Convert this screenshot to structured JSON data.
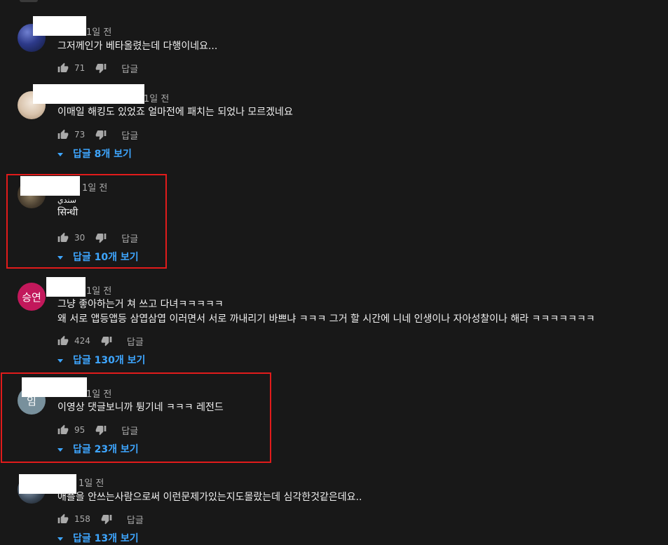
{
  "comments": [
    {
      "time": "1일 전",
      "lines": [
        "그저께인가 베타올렸는데 다행이네요..."
      ],
      "likes": "71",
      "reply_label": "답글",
      "view_replies": ""
    },
    {
      "time": "1일 전",
      "lines": [
        "이매일 해킹도 있었죠 얼마전에 패치는 되었나 모르겠네요"
      ],
      "likes": "73",
      "reply_label": "답글",
      "view_replies": "답글 8개 보기"
    },
    {
      "time": "1일 전",
      "lines": [
        "سندي",
        "सिन्धी"
      ],
      "likes": "30",
      "reply_label": "답글",
      "view_replies": "답글 10개 보기"
    },
    {
      "time": "1일 전",
      "avatar_text": "승연",
      "lines": [
        "그냥 좋아하는거 쳐 쓰고 다녀ㅋㅋㅋㅋㅋ",
        "왜 서로 앱등앱등 삼엽삼엽 이러면서 서로 까내리기 바쁘냐 ㅋㅋㅋ 그거 할 시간에 니네 인생이나 자아성찰이나 해라 ㅋㅋㅋㅋㅋㅋㅋ"
      ],
      "likes": "424",
      "reply_label": "답글",
      "view_replies": "답글 130개 보기"
    },
    {
      "time": "1일 전",
      "avatar_text": "임",
      "lines": [
        "이영상 댓글보니까 튕기네 ㅋㅋㅋ 레전드"
      ],
      "likes": "95",
      "reply_label": "답글",
      "view_replies": "답글 23개 보기"
    },
    {
      "time": "1일 전",
      "lines": [
        "애플을 안쓰는사람으로써 이런문제가있는지도몰랐는데 심각한것같은데요.."
      ],
      "likes": "158",
      "reply_label": "답글",
      "view_replies": "답글 13개 보기"
    }
  ],
  "colors": {
    "background": "#181818",
    "text": "#f1f1f1",
    "meta": "#aaaaaa",
    "link": "#3ea6ff",
    "highlight": "#e11b1b",
    "avatar_pink": "#c2185b",
    "avatar_slate": "#78909c"
  },
  "icons": {
    "like": "thumb-up-icon",
    "dislike": "thumb-down-icon",
    "expand": "caret-down-icon"
  }
}
